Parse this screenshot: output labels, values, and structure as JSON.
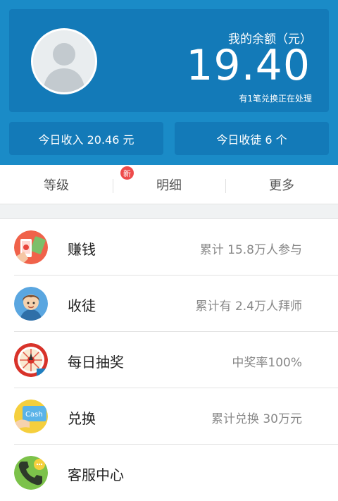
{
  "balance": {
    "label": "我的余额（元）",
    "amount": "19.40",
    "note": "有1笔兑换正在处理"
  },
  "stats": {
    "today_income": "今日收入 20.46 元",
    "today_disciples": "今日收徒 6 个"
  },
  "tabs": [
    {
      "label": "等级"
    },
    {
      "label": "明细",
      "badge": "新"
    },
    {
      "label": "更多"
    }
  ],
  "menu": [
    {
      "title": "赚钱",
      "meta": "累计 15.8万人参与",
      "icon": "earn-money-icon"
    },
    {
      "title": "收徒",
      "meta": "累计有 2.4万人拜师",
      "icon": "recruit-disciple-icon"
    },
    {
      "title": "每日抽奖",
      "meta": "中奖率100%",
      "icon": "lottery-wheel-icon"
    },
    {
      "title": "兑换",
      "meta": "累计兑换 30万元",
      "icon": "cash-card-icon"
    },
    {
      "title": "客服中心",
      "meta": "",
      "icon": "customer-service-phone-icon"
    }
  ],
  "colors": {
    "header_bg": "#1a8bc7",
    "card_bg": "#137ab8",
    "badge_red": "#ee4b4b"
  }
}
